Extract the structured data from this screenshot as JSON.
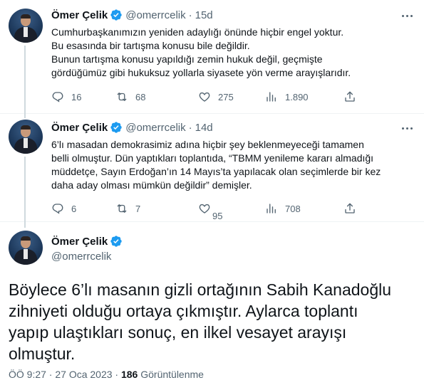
{
  "colors": {
    "verified": "#1d9bf0",
    "text": "#0f1419",
    "muted": "#536471",
    "divider": "#eff3f4"
  },
  "tweets": [
    {
      "name": "Ömer Çelik",
      "handle": "@omerrcelik",
      "time": "15d",
      "lines": [
        "Cumhurbaşkanımızın yeniden adaylığı önünde hiçbir engel yoktur.",
        "Bu esasında bir tartışma konusu bile değildir.",
        "Bunun tartışma konusu yapıldığı zemin hukuk değil,  geçmişte",
        "gördüğümüz gibi  hukuksuz yollarla siyasete yön verme arayışlarıdır."
      ],
      "replies": "16",
      "retweets": "68",
      "likes": "275",
      "views": "1.890"
    },
    {
      "name": "Ömer Çelik",
      "handle": "@omerrcelik",
      "time": "14d",
      "lines": [
        "6’lı masadan demokrasimiz adına hiçbir şey beklenmeyeceği tamamen",
        "belli olmuştur. Dün yaptıkları toplantıda, “TBMM yenileme kararı almadığı",
        "müddetçe, Sayın Erdoğan’ın 14 Mayıs’ta yapılacak olan seçimlerde bir kez",
        "daha aday olması mümkün değildir” demişler."
      ],
      "replies": "6",
      "retweets": "7",
      "likes": "95",
      "views": "708"
    }
  ],
  "main_tweet": {
    "name": "Ömer Çelik",
    "handle": "@omerrcelik",
    "lines": [
      "Böylece 6’lı masanın gizli ortağının Sabih Kanadoğlu",
      "zihniyeti olduğu ortaya çıkmıştır. Aylarca toplantı",
      "yapıp ulaştıkları sonuç, en ilkel vesayet arayışı",
      "olmuştur."
    ],
    "timestamp": "ÖÖ 9:27 · 27 Oca 2023 · ",
    "views_count": "186",
    "views_label": " Görüntülenme"
  }
}
